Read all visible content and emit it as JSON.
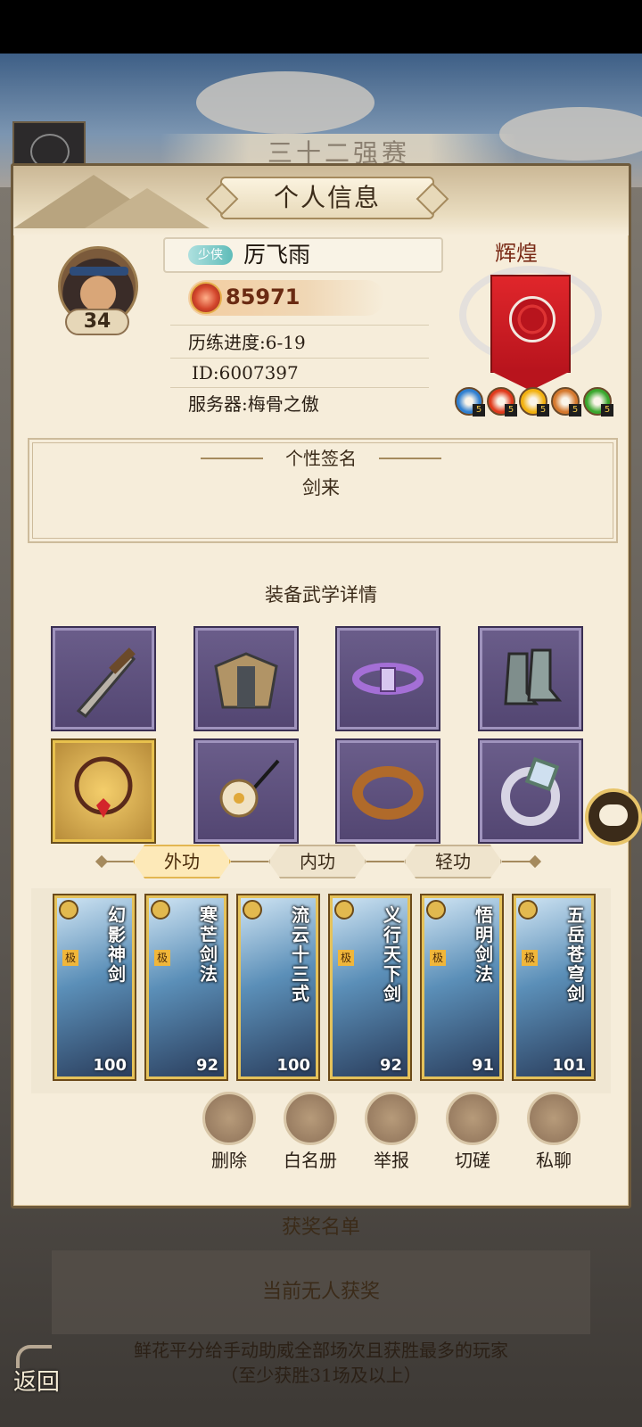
{
  "background": {
    "title": "三十二强赛"
  },
  "panel": {
    "title": "个人信息"
  },
  "player": {
    "level": "34",
    "title_tag": "少侠",
    "name": "厉飞雨",
    "power": "85971",
    "progress": "历练进度:6-19",
    "id": "ID:6007397",
    "server": "服务器:梅骨之傲"
  },
  "rank": {
    "label": "辉煌",
    "banner_color": "#d41f25"
  },
  "elements": [
    {
      "icon": "water-element-icon",
      "color": "#2f7fd0",
      "count": "5"
    },
    {
      "icon": "fire-element-icon",
      "color": "#e03a1c",
      "count": "5"
    },
    {
      "icon": "sun-element-icon",
      "color": "#f2b10f",
      "count": "5"
    },
    {
      "icon": "earth-element-icon",
      "color": "#d5782d",
      "count": "5"
    },
    {
      "icon": "wood-element-icon",
      "color": "#3aa72e",
      "count": "5"
    }
  ],
  "signature": {
    "title": "个性签名",
    "text": "剑来"
  },
  "equipment": {
    "title": "装备武学详情",
    "slots": [
      "sword-icon",
      "armor-icon",
      "belt-icon",
      "boots-icon",
      "necklace-icon",
      "hairpin-icon",
      "bracer-icon",
      "ring-icon"
    ]
  },
  "tabs": [
    {
      "label": "外功",
      "active": true
    },
    {
      "label": "内功",
      "active": false
    },
    {
      "label": "轻功",
      "active": false
    }
  ],
  "skills": [
    {
      "name": "幻影神剑",
      "level": "100",
      "rank": "极"
    },
    {
      "name": "寒芒剑法",
      "level": "92",
      "rank": "极"
    },
    {
      "name": "流云十三式",
      "level": "100",
      "rank": ""
    },
    {
      "name": "义行天下剑",
      "level": "92",
      "rank": "极"
    },
    {
      "name": "悟明剑法",
      "level": "91",
      "rank": "极"
    },
    {
      "name": "五岳苍穹剑",
      "level": "101",
      "rank": "极"
    }
  ],
  "actions": [
    {
      "label": "删除",
      "icon": "delete-friend-icon"
    },
    {
      "label": "白名册",
      "icon": "whitelist-book-icon"
    },
    {
      "label": "举报",
      "icon": "report-book-icon"
    },
    {
      "label": "切磋",
      "icon": "spar-fist-icon"
    },
    {
      "label": "私聊",
      "icon": "private-chat-icon"
    }
  ],
  "reward": {
    "title": "获奖名单",
    "empty": "当前无人获奖",
    "note": "鲜花平分给手动助威全部场次且获胜最多的玩家（至少获胜31场及以上）"
  },
  "back": {
    "label": "返回"
  }
}
